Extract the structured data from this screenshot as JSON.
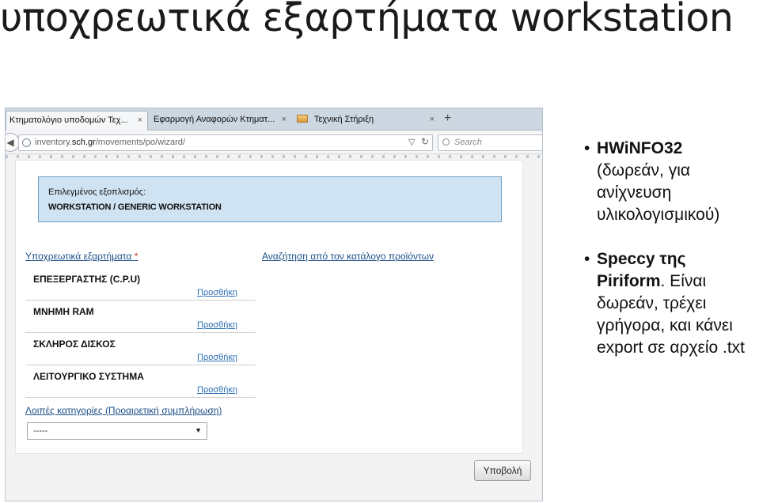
{
  "slide": {
    "title": "υποχρεωτικά εξαρτήματα workstation"
  },
  "browser": {
    "tabs": [
      {
        "label": "Κτηματολόγιο υποδομών Τεχ...",
        "close": "×"
      },
      {
        "label": "Εφαρμογή Αναφορών Κτηματ...",
        "close": "×"
      },
      {
        "label": "Τεχνική Στήριξη",
        "close": "×"
      }
    ],
    "new_tab": "+",
    "url": {
      "prefix": "inventory.",
      "host": "sch.gr",
      "path": "/movements/po/wizard/"
    },
    "search_placeholder": "Search"
  },
  "page": {
    "selected_label": "Επιλεγμένος εξοπλισμός:",
    "selected_value": "WORKSTATION / GENERIC WORKSTATION",
    "required_heading": "Υποχρεωτικά εξαρτήματα",
    "required_asterisk": "*",
    "catalog_heading": "Αναζήτηση από τον κατάλογο προϊόντων",
    "components": [
      {
        "name": "ΕΠΕΞΕΡΓΑΣΤΗΣ (C.P.U)",
        "action": "Προσθήκη"
      },
      {
        "name": "ΜΝΗΜΗ RAM",
        "action": "Προσθήκη"
      },
      {
        "name": "ΣΚΛΗΡΟΣ ΔΙΣΚΟΣ",
        "action": "Προσθήκη"
      },
      {
        "name": "ΛΕΙΤΟΥΡΓΙΚΟ ΣΥΣΤΗΜΑ",
        "action": "Προσθήκη"
      }
    ],
    "optional_heading": "Λοιπές κατηγορίες (Προαιρετική συμπλήρωση)",
    "optional_select_value": "-----",
    "submit_label": "Υποβολή"
  },
  "bullets": [
    {
      "bold": "HWiNFO32",
      "rest": "(δωρεάν, για ανίχνευση υλικολογισμικού)"
    },
    {
      "bold": "Speccy της Piriform",
      "rest": ". Είναι δωρεάν, τρέχει γρήγορα, και κάνει export σε αρχείο .txt"
    }
  ]
}
